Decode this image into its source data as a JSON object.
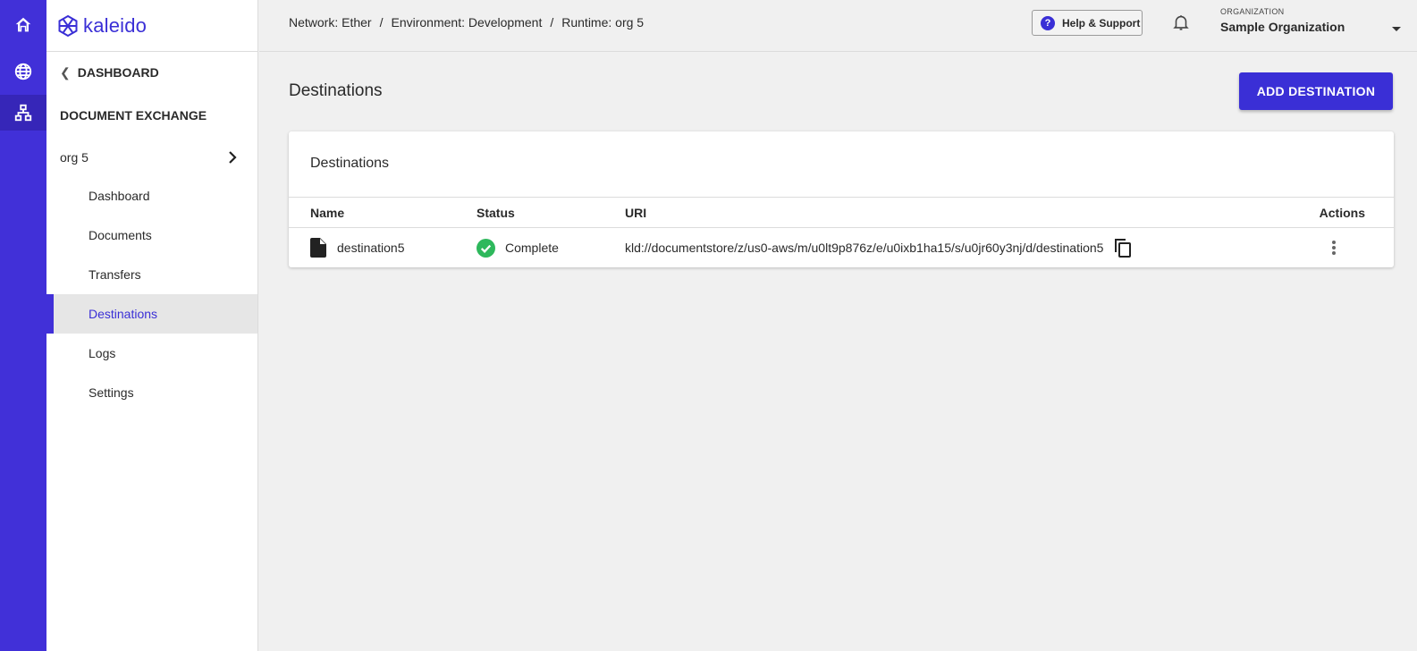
{
  "rail": {
    "items": [
      {
        "icon": "home-icon",
        "active": false
      },
      {
        "icon": "globe-icon",
        "active": false
      },
      {
        "icon": "network-icon",
        "active": true
      }
    ]
  },
  "brand": {
    "name": "kaleido",
    "color": "#3a2fd6"
  },
  "sidebar": {
    "back_label": "DASHBOARD",
    "section_title": "DOCUMENT EXCHANGE",
    "runtime_label": "org 5",
    "items": [
      {
        "label": "Dashboard",
        "active": false
      },
      {
        "label": "Documents",
        "active": false
      },
      {
        "label": "Transfers",
        "active": false
      },
      {
        "label": "Destinations",
        "active": true
      },
      {
        "label": "Logs",
        "active": false
      },
      {
        "label": "Settings",
        "active": false
      }
    ]
  },
  "header": {
    "breadcrumb": [
      "Network: Ether",
      "Environment: Development",
      "Runtime: org 5"
    ],
    "separator": "/",
    "help_label": "Help & Support",
    "org_caption": "ORGANIZATION",
    "org_name": "Sample Organization"
  },
  "main": {
    "title": "Destinations",
    "add_button_label": "ADD DESTINATION",
    "card_title": "Destinations",
    "columns": [
      "Name",
      "Status",
      "URI",
      "Actions"
    ],
    "rows": [
      {
        "name": "destination5",
        "status": "Complete",
        "uri": "kld://documentstore/z/us0-aws/m/u0lt9p876z/e/u0ixb1ha15/s/u0jr60y3nj/d/destination5"
      }
    ]
  },
  "colors": {
    "accent": "#3a2fd6",
    "rail": "#4130d8",
    "success": "#2eb85c"
  }
}
